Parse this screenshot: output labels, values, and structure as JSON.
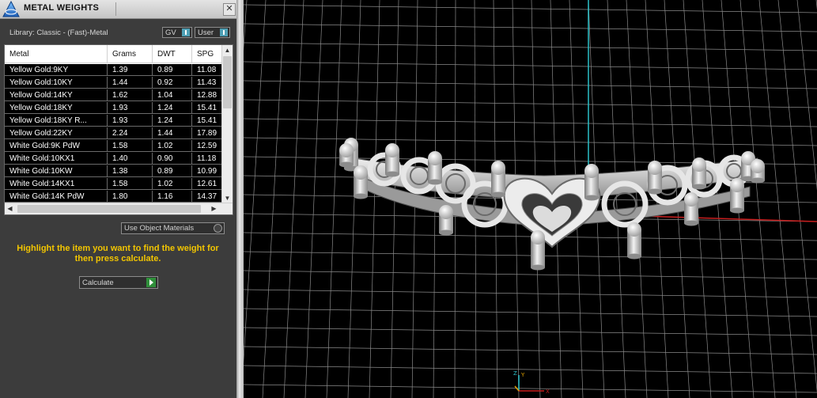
{
  "window": {
    "title": "METAL WEIGHTS",
    "close_glyph": "✕"
  },
  "library_label": "Library: Classic - (Fast)-Metal",
  "toggles": {
    "gv": "GV",
    "user": "User"
  },
  "table": {
    "columns": [
      "Metal",
      "Grams",
      "DWT",
      "SPG"
    ],
    "rows": [
      [
        "Yellow Gold:9KY",
        "1.39",
        "0.89",
        "11.08"
      ],
      [
        "Yellow Gold:10KY",
        "1.44",
        "0.92",
        "11.43"
      ],
      [
        "Yellow Gold:14KY",
        "1.62",
        "1.04",
        "12.88"
      ],
      [
        "Yellow Gold:18KY",
        "1.93",
        "1.24",
        "15.41"
      ],
      [
        "Yellow Gold:18KY R...",
        "1.93",
        "1.24",
        "15.41"
      ],
      [
        "Yellow Gold:22KY",
        "2.24",
        "1.44",
        "17.89"
      ],
      [
        "White Gold:9K PdW",
        "1.58",
        "1.02",
        "12.59"
      ],
      [
        "White Gold:10KX1",
        "1.40",
        "0.90",
        "11.18"
      ],
      [
        "White Gold:10KW",
        "1.38",
        "0.89",
        "10.99"
      ],
      [
        "White Gold:14KX1",
        "1.58",
        "1.02",
        "12.61"
      ],
      [
        "White Gold:14K PdW",
        "1.80",
        "1.16",
        "14.37"
      ]
    ]
  },
  "use_object_materials": "Use Object Materials",
  "instruction": "Highlight the item you want to find the weight for then press calculate.",
  "calculate_button": "Calculate",
  "viewport": {
    "axis_labels": {
      "z": "Z",
      "y": "Y",
      "x": "X"
    },
    "colors": {
      "grid": "#8a8a8a",
      "axis_y": "#2bc0c8",
      "axis_x": "#c81e1e",
      "model": "#d8d8d8",
      "gizmo": "#e0a000"
    }
  }
}
